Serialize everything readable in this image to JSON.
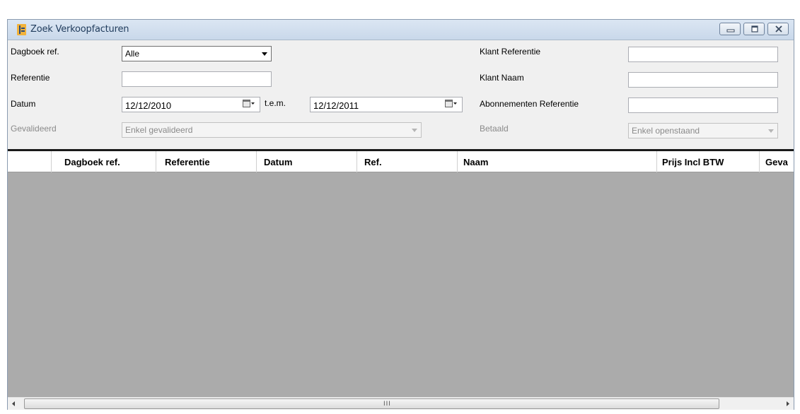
{
  "window": {
    "title": "Zoek Verkoopfacturen",
    "controls": [
      "minimize-icon",
      "restore-icon",
      "close-icon"
    ]
  },
  "filters": {
    "dagboek_label": "Dagboek ref.",
    "dagboek_value": "Alle",
    "referentie_label": "Referentie",
    "referentie_value": "",
    "datum_label": "Datum",
    "datum_from": "12/12/2010",
    "tem_label": "t.e.m.",
    "datum_to": "12/12/2011",
    "gevalideerd_label": "Gevalideerd",
    "gevalideerd_value": "Enkel gevalideerd",
    "klant_ref_label": "Klant Referentie",
    "klant_ref_value": "",
    "klant_naam_label": "Klant Naam",
    "klant_naam_value": "",
    "abonnementen_label": "Abonnementen Referentie",
    "abonnementen_value": "",
    "betaald_label": "Betaald",
    "betaald_value": "Enkel openstaand"
  },
  "grid": {
    "columns": [
      "Dagboek ref.",
      "Referentie",
      "Datum",
      "Ref.",
      "Naam",
      "Prijs Incl BTW",
      "Geva"
    ],
    "rows": []
  },
  "scrollbar": {
    "grip": "III"
  },
  "colors": {
    "title_text": "#1f3b5c",
    "grid_empty": "#ababab",
    "panel": "#f0f0f0",
    "frame": "#cfdcea"
  }
}
